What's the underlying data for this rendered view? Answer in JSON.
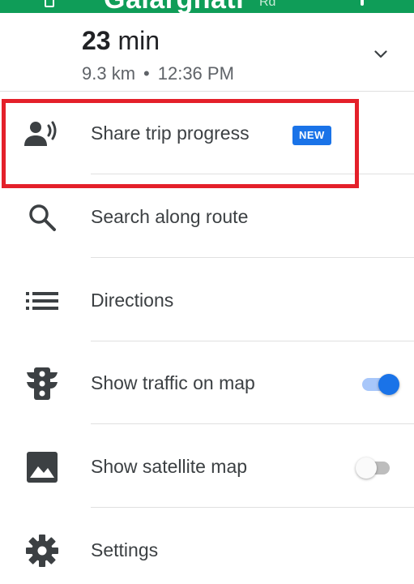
{
  "status_bar": {
    "street_name": "Galarghati",
    "street_suffix": "Rd"
  },
  "trip": {
    "duration_value": "23",
    "duration_unit": "min",
    "distance": "9.3 km",
    "separator": "•",
    "arrival_time": "12:36 PM",
    "expand_icon": "chevron-down-icon"
  },
  "menu": {
    "share_trip": {
      "label": "Share trip progress",
      "badge": "NEW",
      "icon": "share-location-person-icon"
    },
    "search_route": {
      "label": "Search along route",
      "icon": "search-icon"
    },
    "directions": {
      "label": "Directions",
      "icon": "list-icon"
    },
    "traffic": {
      "label": "Show traffic on map",
      "icon": "traffic-light-icon",
      "toggle_on": true
    },
    "satellite": {
      "label": "Show satellite map",
      "icon": "image-icon",
      "toggle_on": false
    },
    "settings": {
      "label": "Settings",
      "icon": "gear-icon"
    }
  },
  "colors": {
    "header_green": "#0f9d58",
    "accent_blue": "#1a73e8",
    "highlight_red": "#e4202a",
    "icon_gray": "#3c4043"
  }
}
